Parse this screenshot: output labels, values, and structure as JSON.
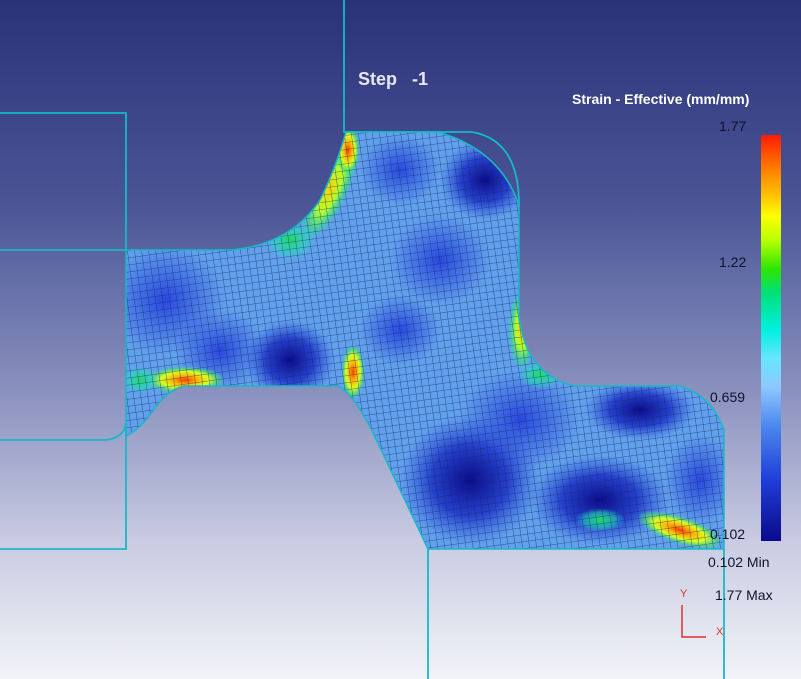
{
  "viewport": {
    "step_label": "Step   -1"
  },
  "legend": {
    "title": "Strain - Effective (mm/mm)",
    "ticks": [
      "1.77",
      "1.22",
      "0.659",
      "0.102"
    ],
    "min_label": "0.102 Min",
    "max_label": "1.77 Max"
  },
  "axis_triad": {
    "y_label": "Y",
    "x_label": "X"
  },
  "colors": {
    "die_outline": "#17b8c8",
    "mesh_line": "#1a2a58",
    "triad": "#e03030"
  }
}
